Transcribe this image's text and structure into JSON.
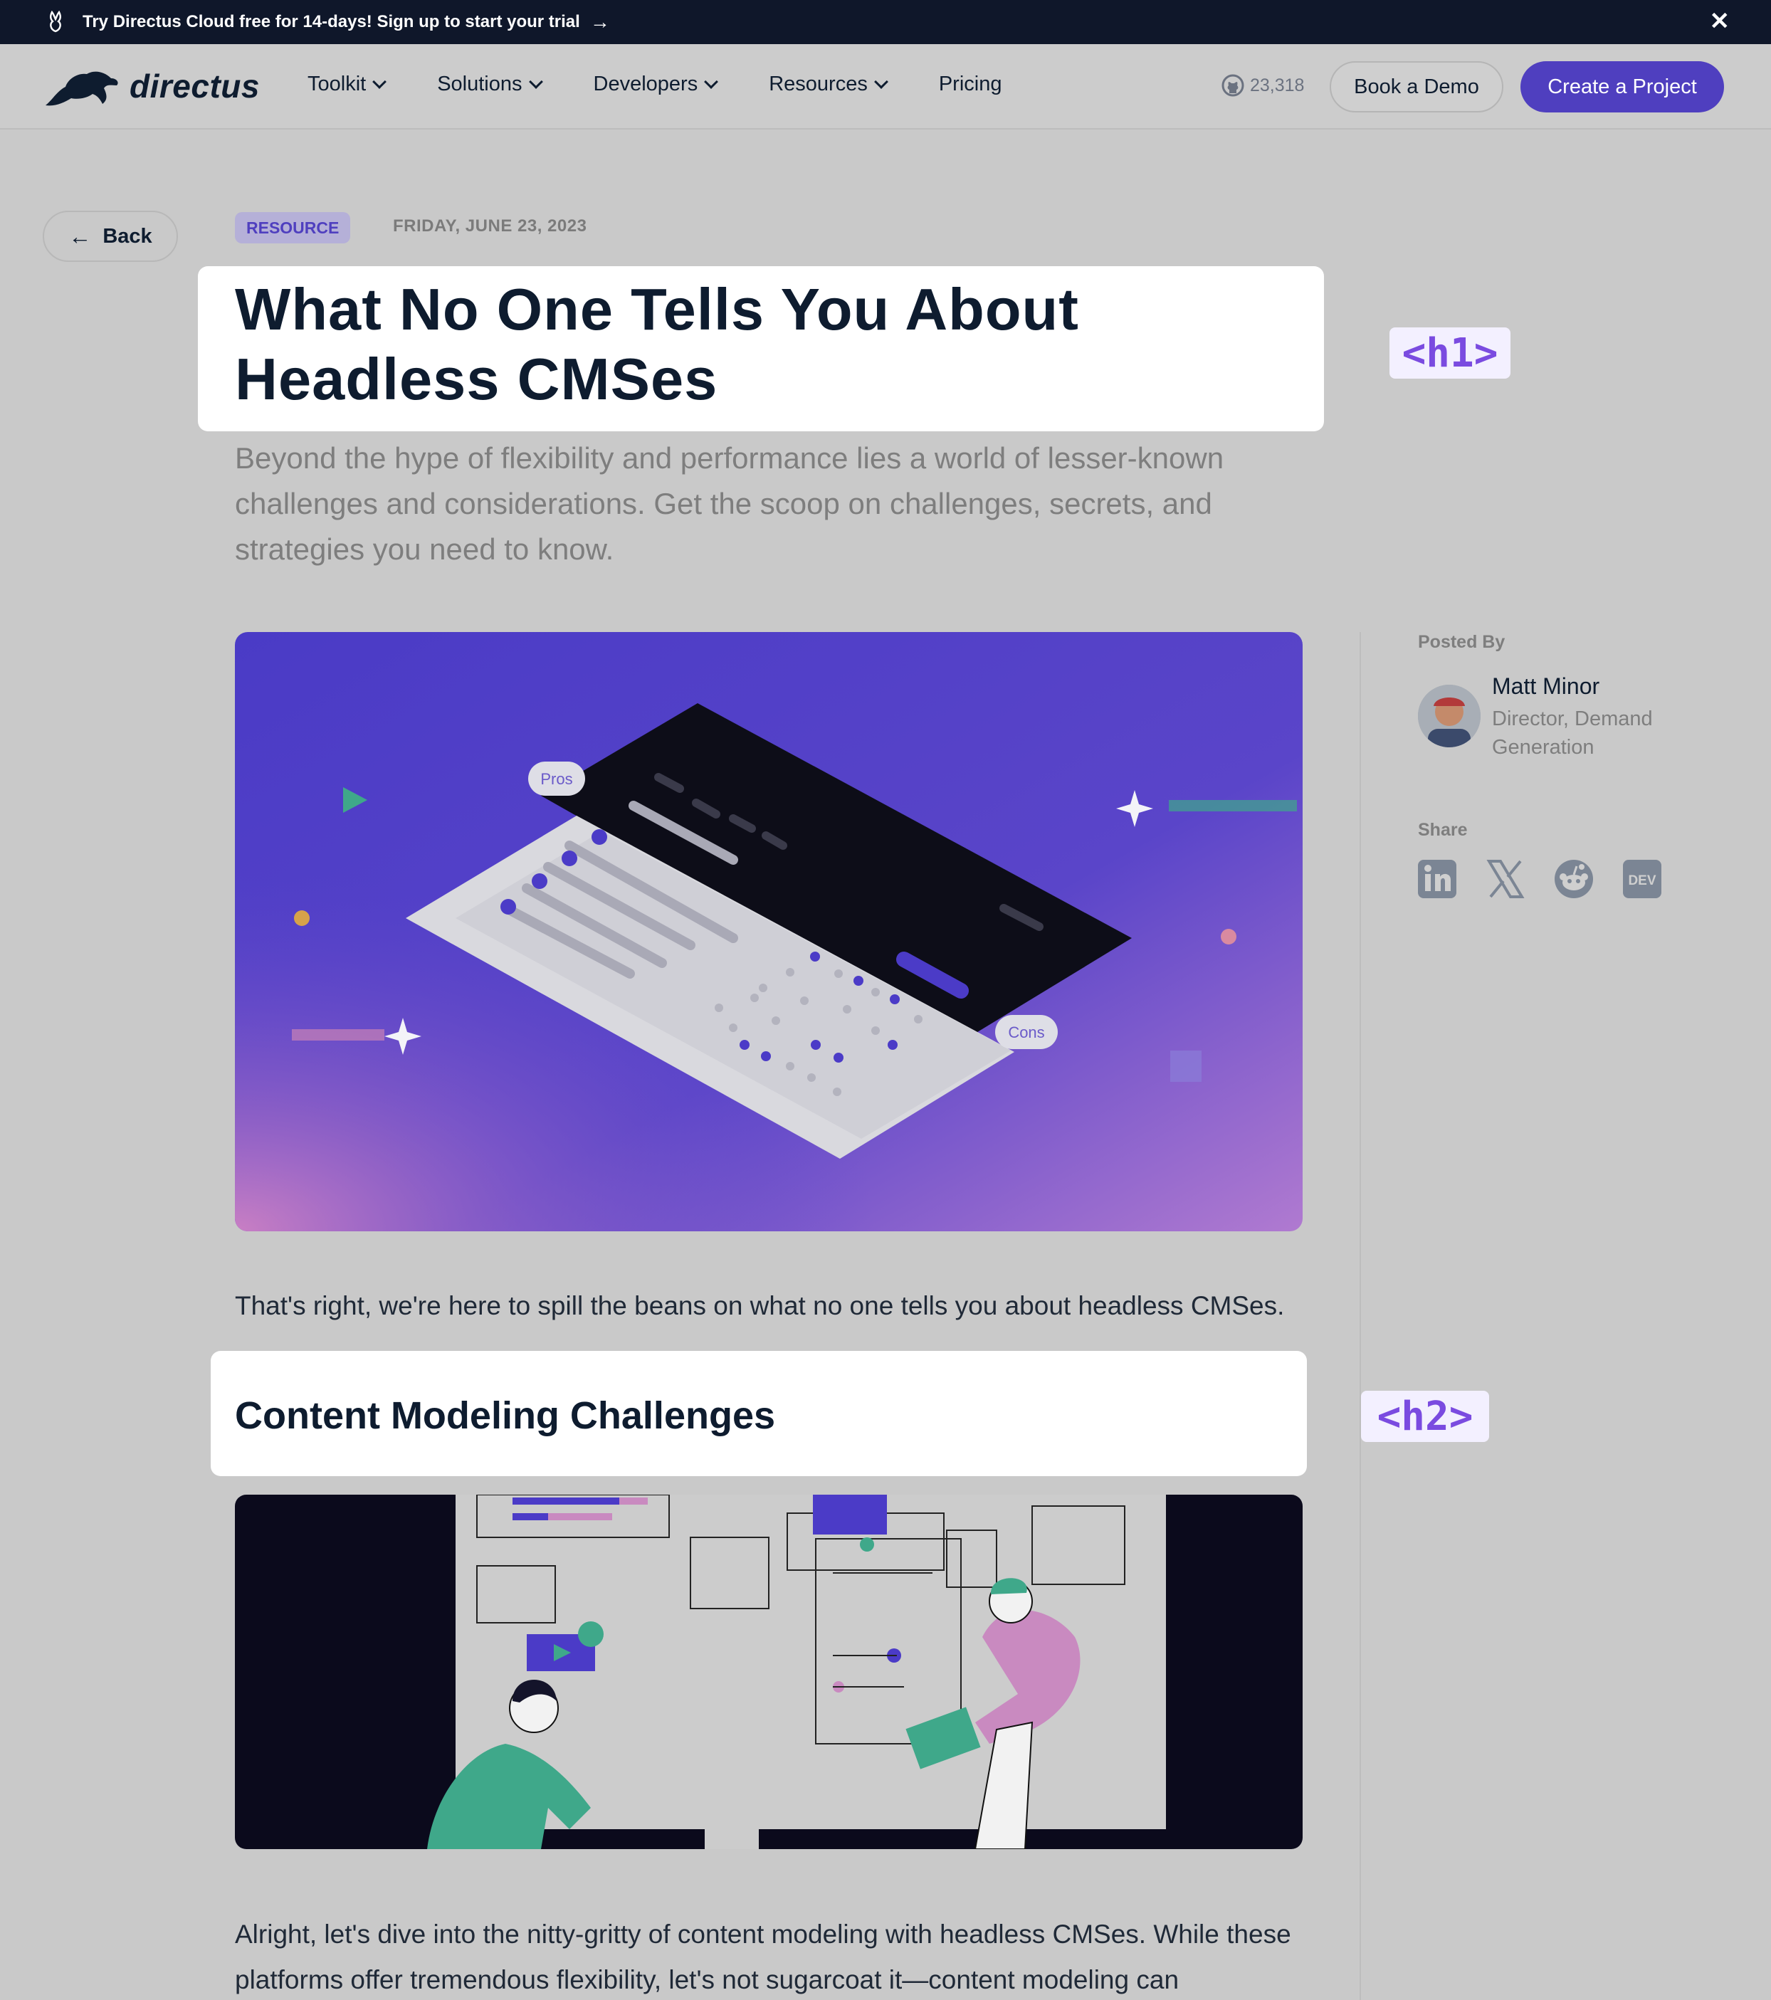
{
  "banner": {
    "text": "Try Directus Cloud free for 14-days! Sign up to start your trial"
  },
  "nav": {
    "logo": "directus",
    "items": [
      {
        "label": "Toolkit",
        "dropdown": true
      },
      {
        "label": "Solutions",
        "dropdown": true
      },
      {
        "label": "Developers",
        "dropdown": true
      },
      {
        "label": "Resources",
        "dropdown": true
      },
      {
        "label": "Pricing",
        "dropdown": false
      }
    ],
    "github_stars": "23,318",
    "book_demo": "Book a Demo",
    "create_project": "Create a Project"
  },
  "article": {
    "back": "Back",
    "tag": "RESOURCE",
    "date": "FRIDAY, JUNE 23, 2023",
    "title": "What No One Tells You About Headless CMSes",
    "subtitle": "Beyond the hype of flexibility and performance lies a world of lesser-known challenges and considerations. Get the scoop on challenges, secrets, and strategies you need to know.",
    "hero_labels": {
      "pros": "Pros",
      "cons": "Cons"
    },
    "intro": "That's right, we're here to spill the beans on what no one tells you about headless CMSes.",
    "h2": "Content Modeling Challenges",
    "para": "Alright, let's dive into the nitty-gritty of content modeling with headless CMSes. While these platforms offer tremendous flexibility, let's not sugarcoat it—content modeling can"
  },
  "annotations": {
    "h1": "<h1>",
    "h2": "<h2>"
  },
  "sidebar": {
    "posted_by": "Posted By",
    "author": "Matt Minor",
    "role": "Director, Demand Generation",
    "share": "Share",
    "share_icons": [
      "linkedin-icon",
      "x-icon",
      "reddit-icon",
      "dev-icon"
    ]
  },
  "colors": {
    "accent": "#4f3fbf",
    "banner": "#0f172a",
    "annotation": "#7a4be0"
  }
}
